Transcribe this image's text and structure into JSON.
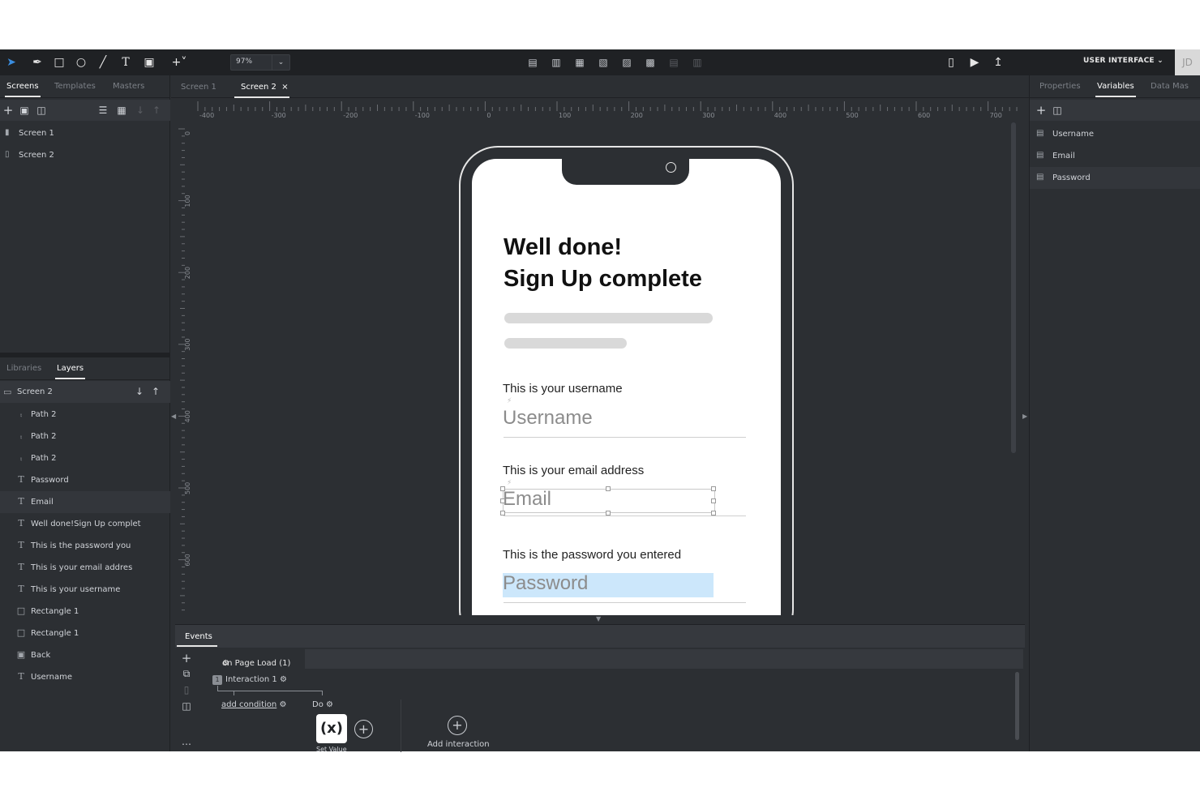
{
  "toolbar": {
    "zoom": "97%",
    "mode_label": "USER INTERFACE",
    "avatar_initials": "JD"
  },
  "left_panel": {
    "tabs": [
      "Screens",
      "Templates",
      "Masters"
    ],
    "screens": [
      "Screen 1",
      "Screen 2"
    ],
    "bottom_tabs": [
      "Libraries",
      "Layers"
    ],
    "layer_root": "Screen 2",
    "layers": [
      {
        "name": "Path 2",
        "icon": "path-icon"
      },
      {
        "name": "Path 2",
        "icon": "path-icon"
      },
      {
        "name": "Path 2",
        "icon": "path-icon"
      },
      {
        "name": "Password",
        "icon": "text-icon"
      },
      {
        "name": "Email",
        "icon": "text-icon"
      },
      {
        "name": "Well done!Sign Up complet",
        "icon": "text-icon"
      },
      {
        "name": "This is the password you",
        "icon": "text-icon"
      },
      {
        "name": "This is your email addres",
        "icon": "text-icon"
      },
      {
        "name": "This is your username",
        "icon": "text-icon"
      },
      {
        "name": "Rectangle 1",
        "icon": "rectangle-icon"
      },
      {
        "name": "Rectangle 1",
        "icon": "rectangle-icon"
      },
      {
        "name": "Back",
        "icon": "component-icon"
      },
      {
        "name": "Username",
        "icon": "text-icon"
      }
    ]
  },
  "doc_tabs": [
    "Screen 1",
    "Screen 2"
  ],
  "ruler": {
    "h_labels": [
      "-400",
      "-300",
      "-200",
      "-100",
      "0",
      "100",
      "200",
      "300",
      "400",
      "500",
      "600",
      "700"
    ],
    "v_labels": [
      "0",
      "100",
      "200",
      "300",
      "400",
      "500",
      "600"
    ]
  },
  "phone": {
    "title_line1": "Well done!",
    "title_line2": "Sign Up complete",
    "username_label": "This is your username",
    "username_value": "Username",
    "email_label": "This is your email address",
    "email_value": "Email",
    "password_label": "This is the password you entered",
    "password_value": "Password"
  },
  "events": {
    "tab": "Events",
    "trigger": "on Page Load (1)",
    "interaction": "Interaction 1",
    "interaction_num": "1",
    "add_condition": "add condition",
    "do": "Do",
    "set_value_icon": "(x)",
    "set_value_label": "Set Value",
    "add_interaction": "Add interaction"
  },
  "right_panel": {
    "tabs": [
      "Properties",
      "Variables",
      "Data Mas"
    ],
    "variables": [
      "Username",
      "Email",
      "Password"
    ]
  },
  "colors": {
    "app_bg": "#2c2f33",
    "toolbar_bg": "#1f2124",
    "accent": "#3a8de0",
    "highlight": "#cce7fb"
  }
}
